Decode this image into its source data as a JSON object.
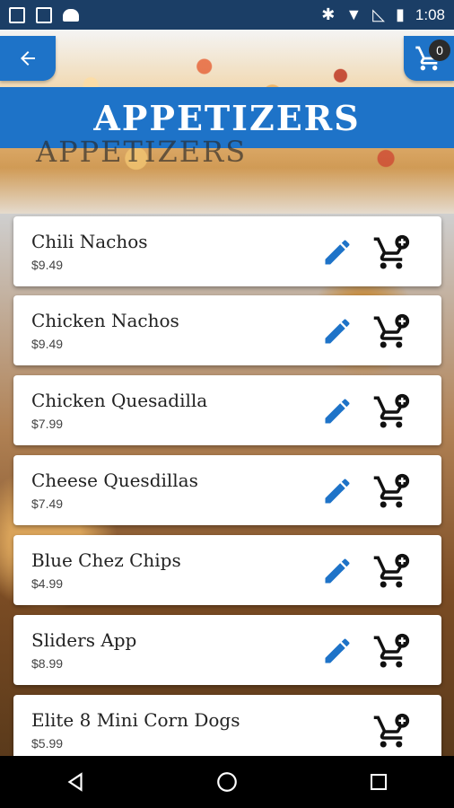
{
  "status_bar": {
    "time": "1:08",
    "icons_left": [
      "image-icon",
      "sd-card-icon",
      "android-icon"
    ],
    "icons_right": [
      "bluetooth-icon",
      "wifi-icon",
      "signal-off-icon",
      "battery-icon"
    ]
  },
  "header": {
    "title": "APPETIZERS",
    "ghost_title": "APPETIZERS",
    "cart_count": "0",
    "accent_color": "#1e73c8"
  },
  "items": [
    {
      "name": "Chili Nachos",
      "price": "$9.49",
      "editable": true
    },
    {
      "name": "Chicken Nachos",
      "price": "$9.49",
      "editable": true
    },
    {
      "name": "Chicken Quesadilla",
      "price": "$7.99",
      "editable": true
    },
    {
      "name": "Cheese Quesdillas",
      "price": "$7.49",
      "editable": true
    },
    {
      "name": "Blue Chez Chips",
      "price": "$4.99",
      "editable": true
    },
    {
      "name": "Sliders App",
      "price": "$8.99",
      "editable": true
    },
    {
      "name": "Elite 8 Mini Corn Dogs",
      "price": "$5.99",
      "editable": false
    }
  ],
  "nav": {
    "buttons": [
      "back-triangle-icon",
      "home-circle-icon",
      "recents-square-icon"
    ]
  }
}
